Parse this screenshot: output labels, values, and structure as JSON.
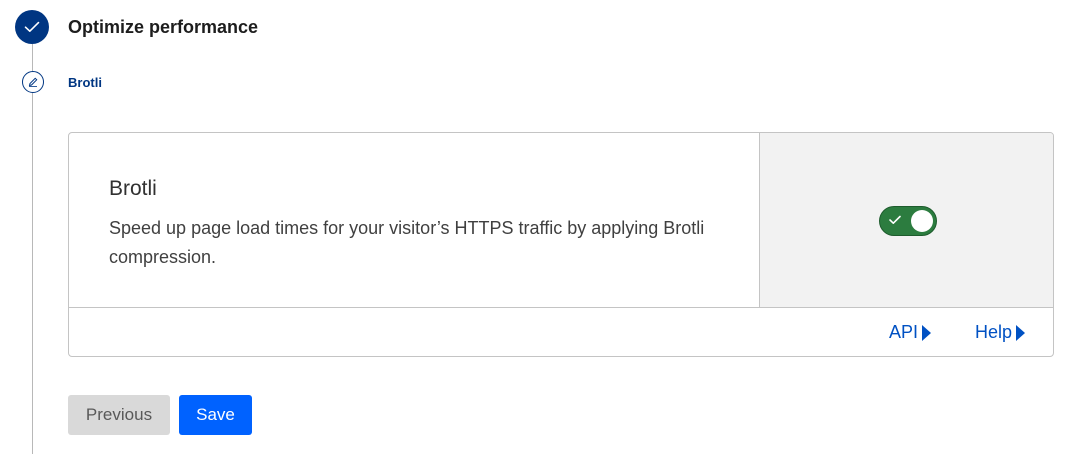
{
  "step": {
    "title": "Optimize performance",
    "status_icon": "check-icon",
    "accent": "#003682"
  },
  "substep": {
    "title": "Brotli",
    "icon": "pencil-icon"
  },
  "card": {
    "title": "Brotli",
    "description": "Speed up page load times for your visitor’s HTTPS traffic by applying Brotli compression.",
    "toggle": {
      "enabled": true,
      "color": "#2c7c3f"
    },
    "links": {
      "api": "API",
      "help": "Help"
    }
  },
  "actions": {
    "previous": "Previous",
    "save": "Save",
    "primary_color": "#0062ff"
  }
}
